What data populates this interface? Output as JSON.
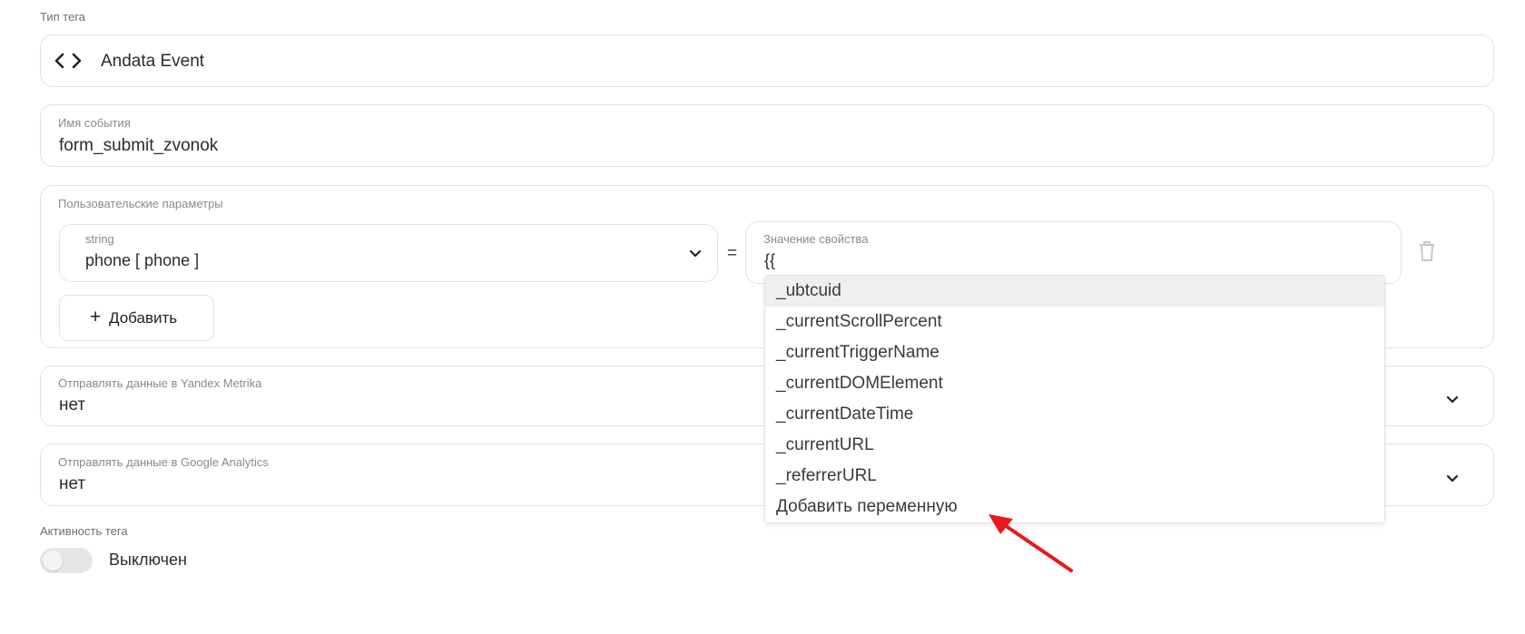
{
  "tag_type": {
    "label": "Тип тега",
    "value": "Andata Event",
    "icon": "code-icon"
  },
  "event_name": {
    "label": "Имя события",
    "value": "form_submit_zvonok"
  },
  "custom_params": {
    "label": "Пользовательские параметры",
    "key_type": "string",
    "key_value": "phone [ phone ]",
    "equals": "=",
    "value_label": "Значение свойства",
    "value_input": "{{",
    "add_label": "+ Добавить",
    "add_plus": "+",
    "add_text": "Добавить"
  },
  "dropdown": {
    "items": [
      "_ubtcuid",
      "_currentScrollPercent",
      "_currentTriggerName",
      "_currentDOMElement",
      "_currentDateTime",
      "_currentURL",
      "_referrerURL",
      "Добавить переменную"
    ],
    "highlighted_index": 0
  },
  "yandex": {
    "label": "Отправлять данные в Yandex Metrika",
    "value": "нет"
  },
  "google": {
    "label": "Отправлять данные в Google Analytics",
    "value": "нет"
  },
  "activity": {
    "label": "Активность тега",
    "status": "Выключен",
    "enabled": false
  },
  "colors": {
    "border": "#e3e3e3",
    "highlight": "#efefef",
    "arrow": "#e8191c",
    "toggle_off": "#e6e6e6"
  }
}
